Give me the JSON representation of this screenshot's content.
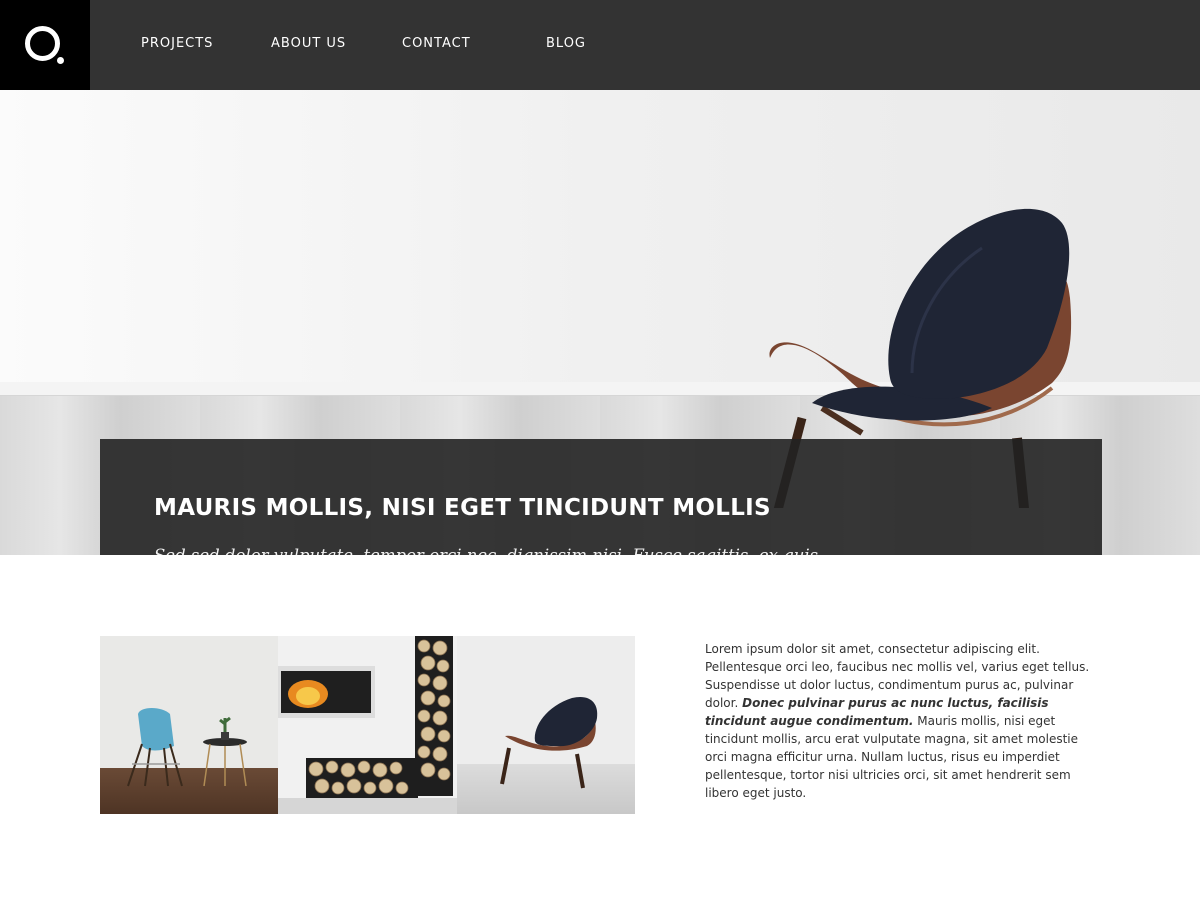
{
  "nav": {
    "items": [
      {
        "label": "PROJECTS"
      },
      {
        "label": "ABOUT US"
      },
      {
        "label": "CONTACT"
      },
      {
        "label": "BLOG"
      }
    ]
  },
  "hero": {
    "title": "MAURIS MOLLIS, NISI EGET TINCIDUNT MOLLIS",
    "subtitle": "Sed sed dolor vulputate, tempor orci nec, dignissim nisi. Fusce sagittis, ex quis dignissim imperdiet, sapien odio interdum nulla."
  },
  "content": {
    "paragraph_start": "Lorem ipsum dolor sit amet, consectetur adipiscing elit. Pellentesque orci leo, faucibus nec mollis vel, varius eget tellus. Suspendisse ut dolor luctus, condimentum purus ac, pulvinar dolor. ",
    "paragraph_emphasis": "Donec pulvinar purus ac nunc luctus, facilisis tincidunt augue condimentum.",
    "paragraph_end": " Mauris mollis, nisi eget tincidunt mollis, arcu erat vulputate magna, sit amet molestie orci magna efficitur urna. Nullam luctus, risus eu imperdiet pellentesque, tortor nisi ultricies orci, sit amet hendrerit sem libero eget justo."
  },
  "colors": {
    "nav_background": "#333333",
    "logo_background": "#000000",
    "overlay": "#222222",
    "chair_seat": "#1f2535",
    "chair_wood": "#6b3a26",
    "side_chair": "#5aa9c9"
  },
  "icons": {
    "logo": "circle-dot-logo-icon"
  }
}
